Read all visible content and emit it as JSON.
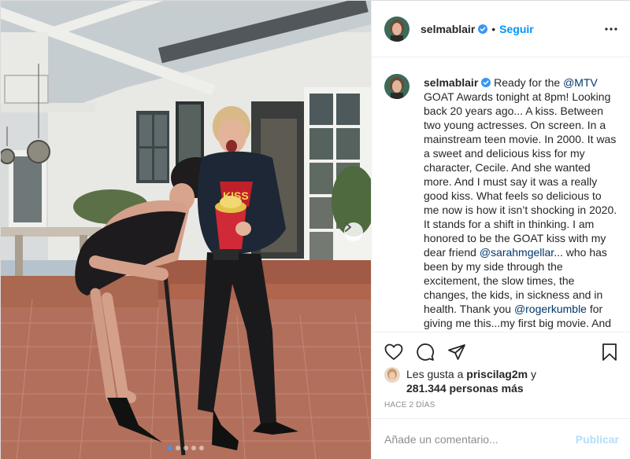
{
  "post": {
    "username": "selmablair",
    "verified": true,
    "follow_label": "Seguir",
    "separator": "•",
    "more_icon": "ellipsis-icon",
    "caption": {
      "username": "selmablair",
      "segments": [
        {
          "text": " Ready for the ",
          "mention": false
        },
        {
          "text": "@MTV",
          "mention": true
        },
        {
          "text": " GOAT Awards tonight at 8pm! Looking back 20 years ago... A kiss. Between two young actresses. On screen. In a mainstream teen movie. In 2000. It was a sweet and delicious kiss for my character, Cecile. And she wanted more. And I must say it was a really good kiss. What feels so delicious to me now is how it isn’t shocking in 2020. It stands for a shift in thinking.  I am honored to be the GOAT kiss with my dear friend ",
          "mention": false
        },
        {
          "text": "@sarahmgellar",
          "mention": true
        },
        {
          "text": "...  who has been by my side through the excitement, the slow times, the changes, the kids, in sickness and in health. Thank you ",
          "mention": false
        },
        {
          "text": "@rogerkumble",
          "mention": true
        },
        {
          "text": " for giving me this...my first big movie. And for giving me this",
          "mention": false
        }
      ]
    },
    "actions": {
      "like_icon": "heart-icon",
      "comment_icon": "comment-icon",
      "share_icon": "paper-plane-icon",
      "save_icon": "bookmark-icon"
    },
    "likes": {
      "prefix": "Les gusta a ",
      "liked_by": "priscilag2m",
      "connector": " y",
      "count_text": "281.344 personas más"
    },
    "timestamp": "HACE 2 DÍAS",
    "comment": {
      "placeholder": "Añade un comentario...",
      "value": "",
      "publish_label": "Publicar"
    },
    "carousel": {
      "total": 5,
      "active_index": 0
    }
  },
  "colors": {
    "link_blue": "#0095f6",
    "mention_blue": "#00376b",
    "publish_disabled": "#b2dffc",
    "muted": "#8e8e8e",
    "verified_badge": "#3897f0"
  }
}
